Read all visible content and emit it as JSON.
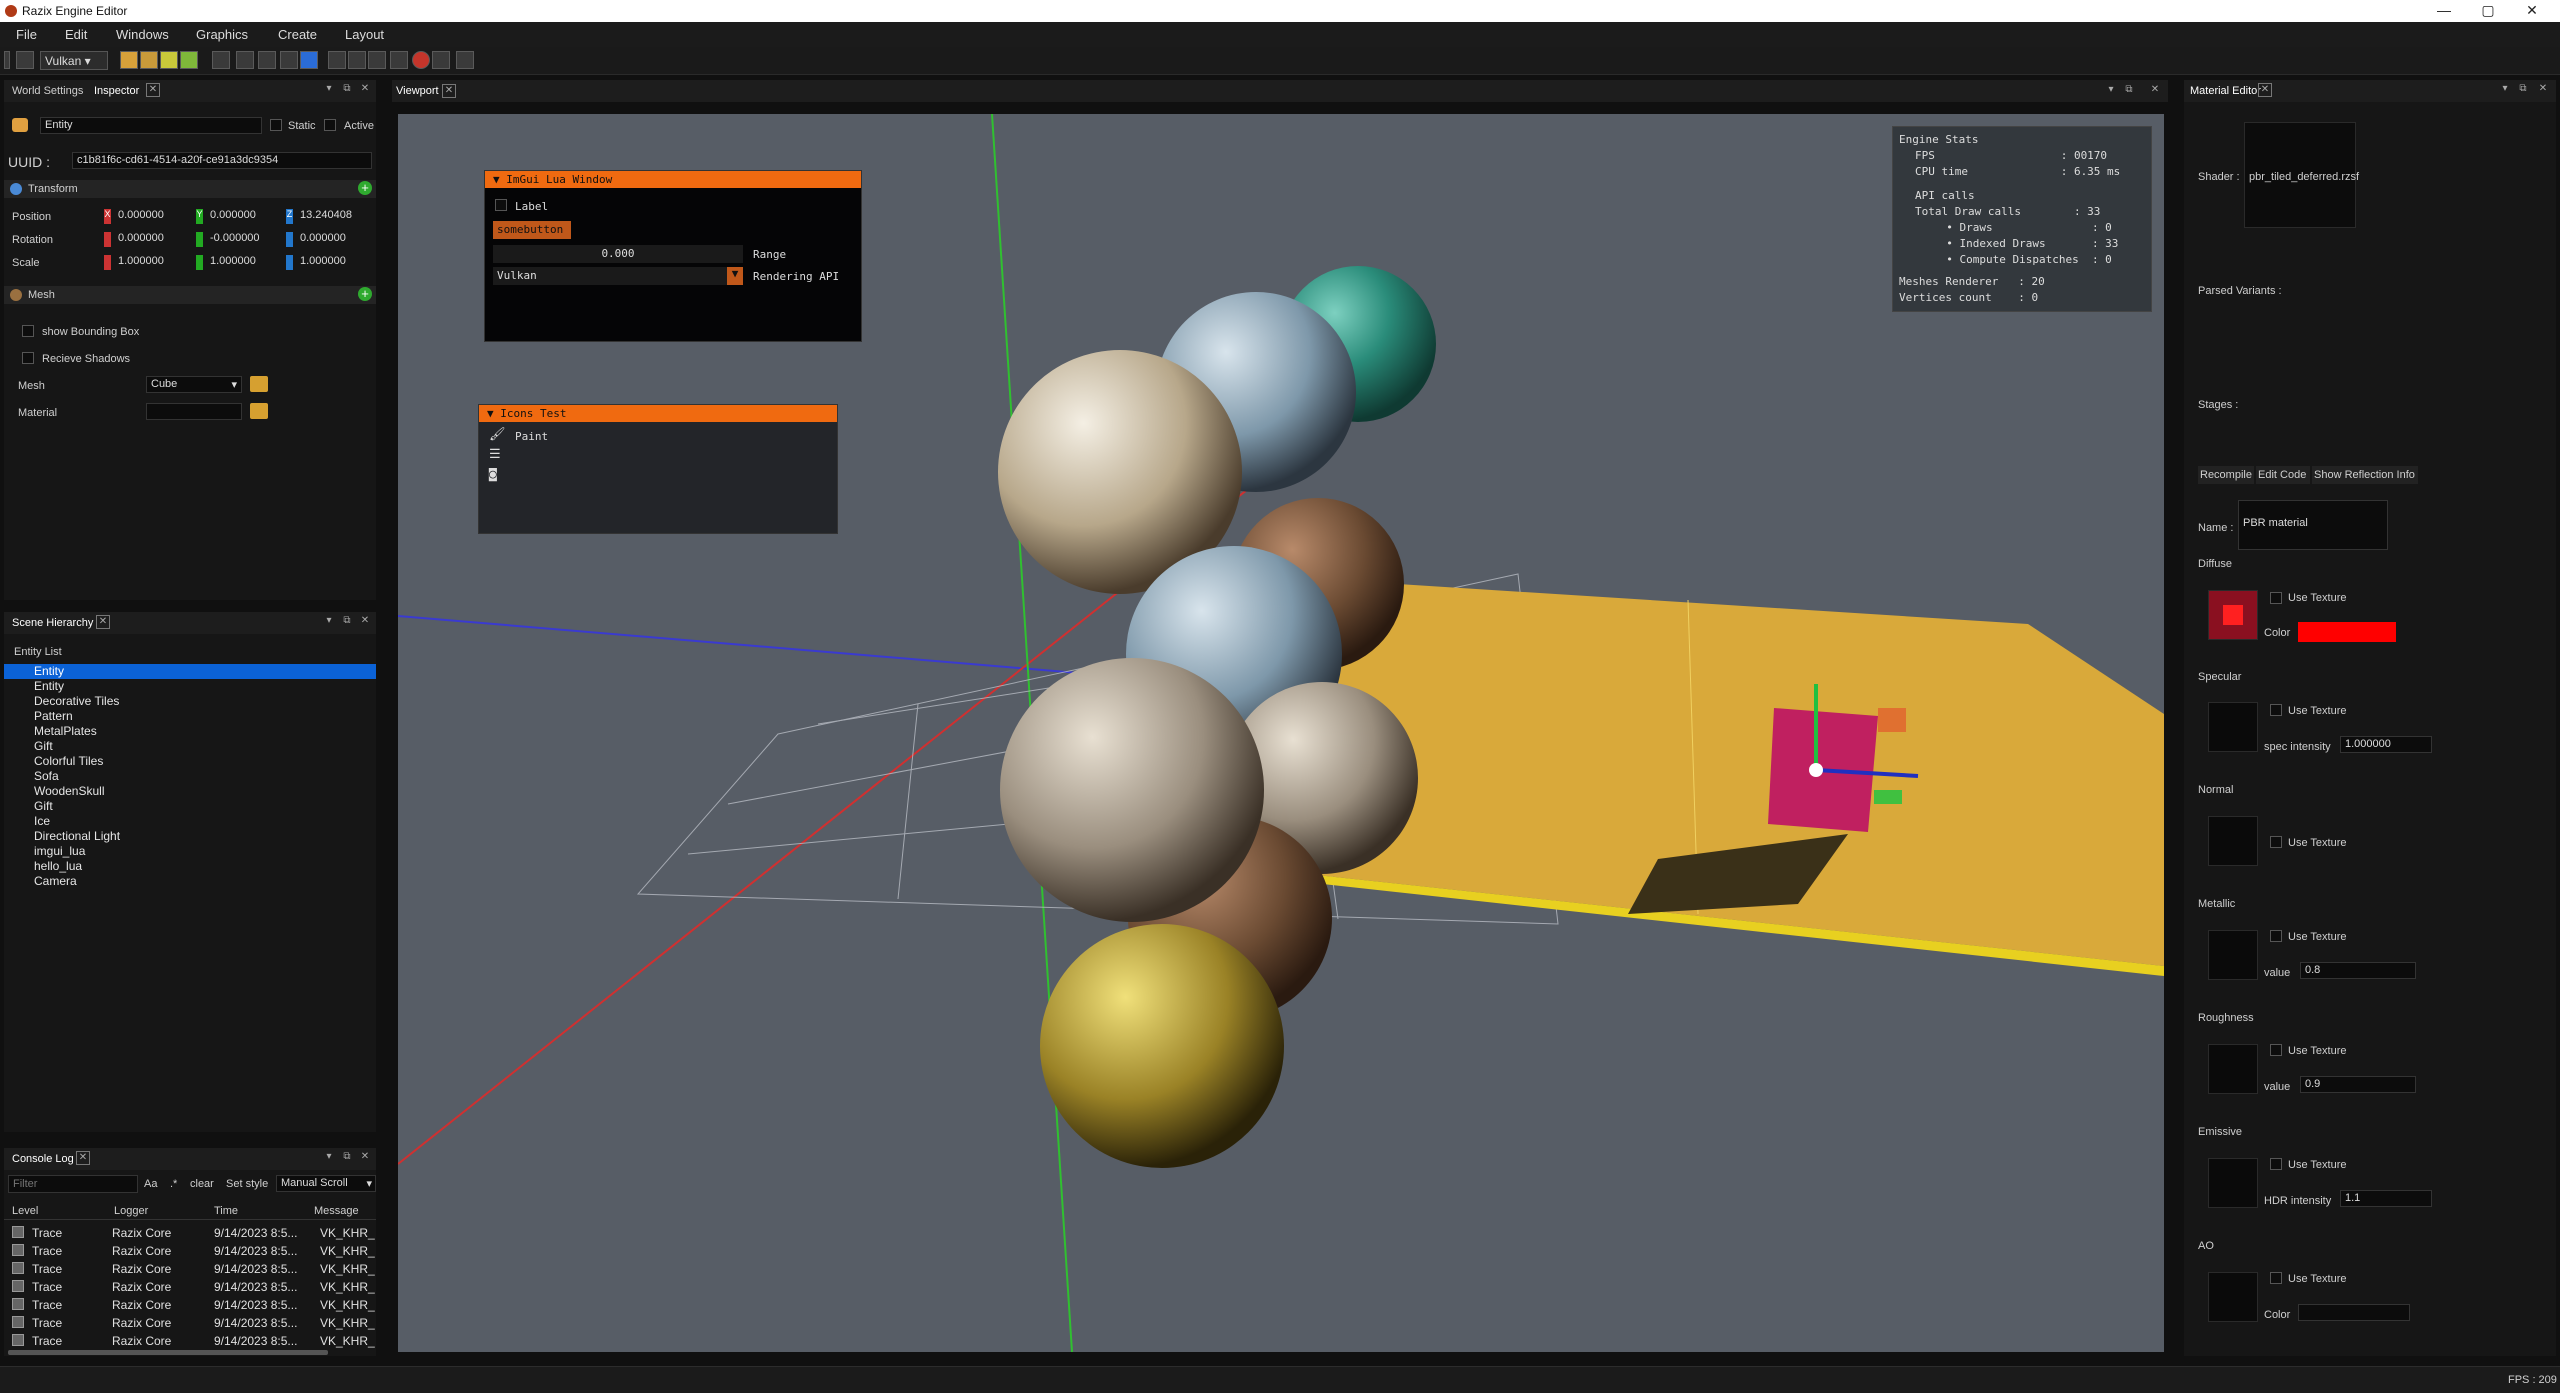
{
  "window": {
    "title": "Razix Engine Editor",
    "min": "—",
    "max": "▢",
    "close": "✕"
  },
  "menu": [
    "File",
    "Edit",
    "Windows",
    "Graphics",
    "Create",
    "Layout"
  ],
  "toolbar": {
    "api_select": "Vulkan"
  },
  "left_tabs": {
    "world": "World Settings",
    "inspector": "Inspector"
  },
  "inspector": {
    "entity_name": "Entity",
    "static_label": "Static",
    "active_label": "Active",
    "uuid_label": "UUID :",
    "uuid": "c1b81f6c-cd61-4514-a20f-ce91a3dc9354",
    "transform_label": "Transform",
    "rows": [
      {
        "label": "Position",
        "x": "0.000000",
        "y": "0.000000",
        "z": "13.240408"
      },
      {
        "label": "Rotation",
        "x": "0.000000",
        "y": "-0.000000",
        "z": "0.000000"
      },
      {
        "label": "Scale",
        "x": "1.000000",
        "y": "1.000000",
        "z": "1.000000"
      }
    ],
    "mesh_section": "Mesh",
    "show_bbox": "show Bounding Box",
    "receive_shadows": "Recieve Shadows",
    "mesh_label": "Mesh",
    "mesh_value": "Cube",
    "material_label": "Material",
    "material_value": ""
  },
  "scene": {
    "tab": "Scene Hierarchy",
    "list_title": "Entity List",
    "items": [
      "Entity",
      "Entity",
      "Decorative Tiles",
      "Pattern",
      "MetalPlates",
      "Gift",
      "Colorful Tiles",
      "Sofa",
      "WoodenSkull",
      "Gift",
      "Ice",
      "Directional Light",
      "imgui_lua",
      "hello_lua",
      "Camera"
    ]
  },
  "console": {
    "tab": "Console Log",
    "filter_placeholder": "Filter",
    "aa": "Aa",
    "dot": ".*",
    "clear": "clear",
    "set_style": "Set style",
    "scroll_mode": "Manual Scroll",
    "headers": [
      "Level",
      "Logger",
      "Time",
      "Message"
    ],
    "rows": [
      [
        "Trace",
        "Razix Core",
        "9/14/2023 8:5...",
        "VK_KHR_"
      ],
      [
        "Trace",
        "Razix Core",
        "9/14/2023 8:5...",
        "VK_KHR_"
      ],
      [
        "Trace",
        "Razix Core",
        "9/14/2023 8:5...",
        "VK_KHR_"
      ],
      [
        "Trace",
        "Razix Core",
        "9/14/2023 8:5...",
        "VK_KHR_"
      ],
      [
        "Trace",
        "Razix Core",
        "9/14/2023 8:5...",
        "VK_KHR_"
      ],
      [
        "Trace",
        "Razix Core",
        "9/14/2023 8:5...",
        "VK_KHR_"
      ],
      [
        "Trace",
        "Razix Core",
        "9/14/2023 8:5...",
        "VK_KHR_"
      ]
    ]
  },
  "viewport": {
    "tab": "Viewport",
    "lua_window": {
      "title": "ImGui Lua Window",
      "label": "Label",
      "button": "somebutton",
      "value": "0.000",
      "range_label": "Range",
      "api": "Vulkan",
      "api_label": "Rendering API"
    },
    "icons_window": {
      "title": "Icons Test",
      "paint": "Paint"
    },
    "stats": {
      "title": "Engine Stats",
      "lines": [
        "FPS                   : 00170",
        "CPU time              : 6.35 ms",
        "",
        "API calls",
        "Total Draw calls        : 33",
        "  • Draws               : 0",
        "  • Indexed Draws       : 33",
        "  • Compute Dispatches  : 0",
        "Meshes Renderer   : 20",
        "Vertices count    : 0"
      ]
    }
  },
  "material": {
    "tab": "Material Editor",
    "shader_label": "Shader :",
    "shader": "pbr_tiled_deferred.rzsf",
    "parsed_variants": "Parsed Variants :",
    "stages": "Stages :",
    "recompile": "Recompile",
    "edit_code": "Edit Code",
    "show_reflection": "Show Reflection Info",
    "name_label": "Name :",
    "name": "PBR material",
    "diffuse": "Diffuse",
    "specular": "Specular",
    "normal": "Normal",
    "metallic": "Metallic",
    "roughness": "Roughness",
    "emissive": "Emissive",
    "ao": "AO",
    "use_texture": "Use Texture",
    "color_label": "Color",
    "spec_label": "spec intensity",
    "spec": "1.000000",
    "value_label": "value",
    "metallic_value": "0.8",
    "roughness_value": "0.9",
    "hdr_label": "HDR intensity",
    "hdr": "1.1",
    "diffuse_color": "#ff0000"
  },
  "status": {
    "fps": "FPS : 209"
  }
}
